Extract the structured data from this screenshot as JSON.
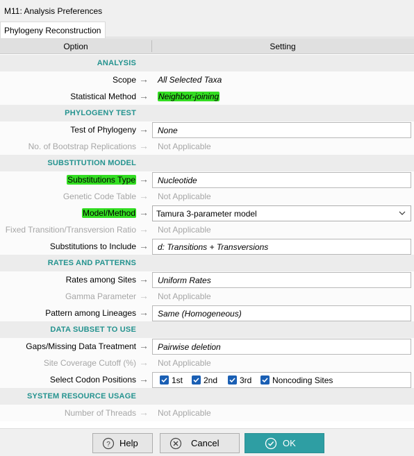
{
  "window": {
    "title": "M11: Analysis Preferences"
  },
  "tabs": [
    {
      "label": "Phylogeny Reconstruction",
      "active": true
    }
  ],
  "columns": {
    "option": "Option",
    "setting": "Setting"
  },
  "sections": [
    {
      "title": "ANALYSIS"
    },
    {
      "title": "PHYLOGENY TEST"
    },
    {
      "title": "SUBSTITUTION MODEL"
    },
    {
      "title": "RATES AND PATTERNS"
    },
    {
      "title": "DATA SUBSET TO USE"
    },
    {
      "title": "SYSTEM RESOURCE USAGE"
    }
  ],
  "options": {
    "scope": {
      "label": "Scope",
      "value": "All Selected Taxa"
    },
    "statistical_method": {
      "label": "Statistical Method",
      "value": "Neighbor-joining"
    },
    "test_of_phylogeny": {
      "label": "Test of Phylogeny",
      "value": "None"
    },
    "bootstrap_replications": {
      "label": "No. of Bootstrap Replications",
      "value": "Not Applicable"
    },
    "substitutions_type": {
      "label": "Substitutions Type",
      "value": "Nucleotide"
    },
    "genetic_code_table": {
      "label": "Genetic Code Table",
      "value": "Not Applicable"
    },
    "model_method": {
      "label": "Model/Method",
      "value": "Tamura 3-parameter model"
    },
    "fixed_ratio": {
      "label": "Fixed Transition/Transversion Ratio",
      "value": "Not Applicable"
    },
    "substitutions_to_include": {
      "label": "Substitutions to Include",
      "value": "d: Transitions + Transversions"
    },
    "rates_among_sites": {
      "label": "Rates among Sites",
      "value": "Uniform Rates"
    },
    "gamma_parameter": {
      "label": "Gamma Parameter",
      "value": "Not Applicable"
    },
    "pattern_among_lineages": {
      "label": "Pattern among Lineages",
      "value": "Same (Homogeneous)"
    },
    "gaps_missing": {
      "label": "Gaps/Missing Data Treatment",
      "value": "Pairwise deletion"
    },
    "site_coverage": {
      "label": "Site Coverage Cutoff (%)",
      "value": "Not Applicable"
    },
    "codon_positions": {
      "label": "Select Codon Positions",
      "choices": [
        {
          "label": "1st",
          "checked": true
        },
        {
          "label": "2nd",
          "checked": true
        },
        {
          "label": "3rd",
          "checked": true
        },
        {
          "label": "Noncoding Sites",
          "checked": true
        }
      ]
    },
    "number_of_threads": {
      "label": "Number of Threads",
      "value": "Not Applicable"
    }
  },
  "buttons": {
    "help": "Help",
    "cancel": "Cancel",
    "ok": "OK"
  },
  "colors": {
    "section_header": "#24938f",
    "highlight": "#33dd22",
    "ok_button": "#2e9ea3",
    "checkbox": "#1a5fb4",
    "disabled_text": "#a6a6a6"
  },
  "icons": {
    "row_arrow": "right-arrow-icon",
    "dropdown": "chevron-down-icon",
    "help": "question-icon",
    "cancel": "x-circle-icon",
    "ok": "check-circle-icon"
  }
}
